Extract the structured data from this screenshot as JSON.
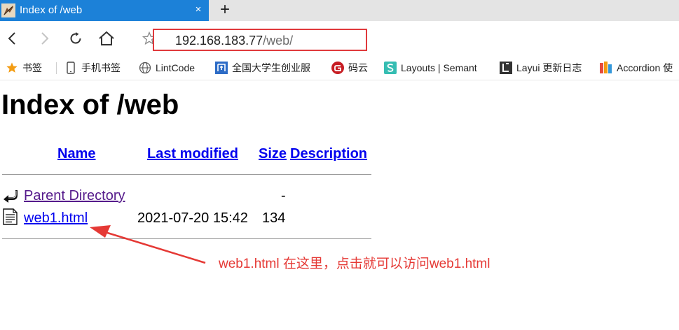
{
  "tab": {
    "title": "Index of /web",
    "close": "×",
    "new_tab": "+"
  },
  "address": {
    "host": "192.168.183.77",
    "path": "/web/"
  },
  "bookmarks": [
    {
      "label": "书签",
      "icon": "star-icon"
    },
    {
      "label": "手机书签",
      "icon": "phone-icon"
    },
    {
      "label": "LintCode",
      "icon": "globe-icon"
    },
    {
      "label": "全国大学生创业服",
      "icon": "site-logo-icon"
    },
    {
      "label": "码云",
      "icon": "gitee-icon"
    },
    {
      "label": "Layouts | Semant",
      "icon": "semantic-ui-icon"
    },
    {
      "label": "Layui 更新日志",
      "icon": "layui-icon"
    },
    {
      "label": "Accordion 使",
      "icon": "color-bars-icon"
    }
  ],
  "page": {
    "title": "Index of /web",
    "headers": {
      "name": "Name",
      "last_modified": "Last modified",
      "size": "Size",
      "description": "Description"
    },
    "rows": [
      {
        "name": "Parent Directory",
        "modified": "",
        "size": "-",
        "icon": "back-arrow-icon"
      },
      {
        "name": "web1.html",
        "modified": "2021-07-20 15:42",
        "size": "134",
        "icon": "text-file-icon"
      }
    ]
  },
  "annotation": {
    "text": "web1.html 在这里，点击就可以访问web1.html",
    "color": "#e53935"
  },
  "colors": {
    "tab_active": "#1c81d8",
    "link": "#0000ee",
    "visited_link": "#551a8b",
    "highlight_box": "#e0393c"
  }
}
